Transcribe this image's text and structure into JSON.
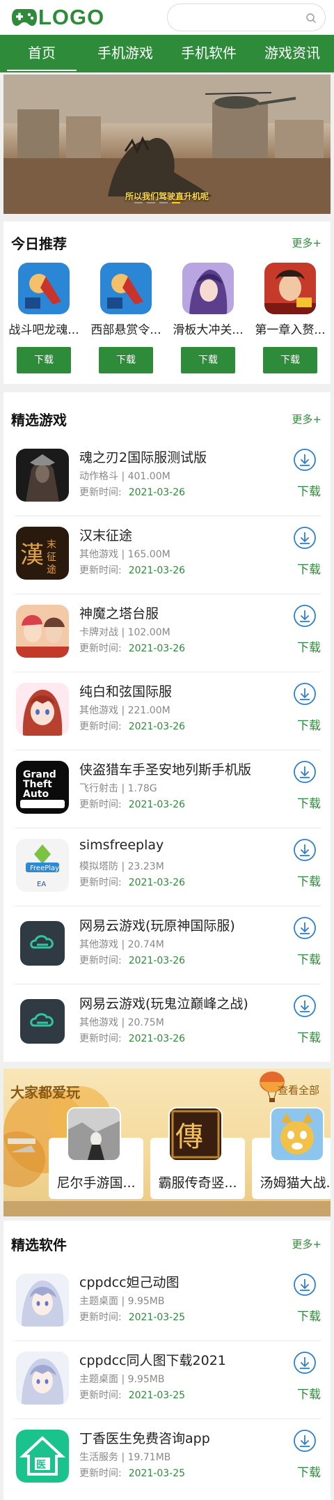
{
  "header": {
    "logo_text": "LOGO",
    "search_placeholder": ""
  },
  "nav": {
    "items": [
      "首页",
      "手机游戏",
      "手机软件",
      "游戏资讯"
    ],
    "active_index": 0
  },
  "banner": {
    "caption": "所以我们驾驶直升机呢",
    "slide_count": 4,
    "active_slide": 3
  },
  "today": {
    "title": "今日推荐",
    "more": "更多+",
    "items": [
      {
        "name": "战斗吧龙魂...",
        "button": "下载"
      },
      {
        "name": "西部悬赏令...",
        "button": "下载"
      },
      {
        "name": "滑板大冲关...",
        "button": "下载"
      },
      {
        "name": "第一章入赘...",
        "button": "下载"
      }
    ]
  },
  "featured_games": {
    "title": "精选游戏",
    "more": "更多+",
    "date_label": "更新时间:",
    "download_label": "下载",
    "items": [
      {
        "name": "魂之刃2国际服测试版",
        "meta": "动作格斗 | 401.00M",
        "date": "2021-03-26",
        "icon": "dark-warrior-icon"
      },
      {
        "name": "汉末征途",
        "meta": "其他游戏 | 165.00M",
        "date": "2021-03-26",
        "icon": "han-calligraphy-icon"
      },
      {
        "name": "神魔之塔台服",
        "meta": "卡牌对战 | 102.00M",
        "date": "2021-03-26",
        "icon": "tower-heroes-icon"
      },
      {
        "name": "纯白和弦国际服",
        "meta": "其他游戏 | 221.00M",
        "date": "2021-03-26",
        "icon": "anime-girl-icon"
      },
      {
        "name": "侠盗猎车手圣安地列斯手机版",
        "meta": "飞行射击 | 1.78G",
        "date": "2021-03-26",
        "icon": "gta-icon"
      },
      {
        "name": "simsfreeplay",
        "meta": "模拟塔防 | 23.23M",
        "date": "2021-03-26",
        "icon": "freeplay-icon"
      },
      {
        "name": "网易云游戏(玩原神国际服)",
        "meta": "其他游戏 | 20.74M",
        "date": "2021-03-26",
        "icon": "cloud-game-icon"
      },
      {
        "name": "网易云游戏(玩鬼泣巅峰之战)",
        "meta": "其他游戏 | 20.75M",
        "date": "2021-03-26",
        "icon": "cloud-game-icon"
      }
    ]
  },
  "popular": {
    "title": "大家都爱玩",
    "view_all": "查看全部",
    "items": [
      {
        "name": "尼尔手游国..."
      },
      {
        "name": "霸服传奇竖..."
      },
      {
        "name": "汤姆猫大战..."
      }
    ]
  },
  "featured_software": {
    "title": "精选软件",
    "more": "更多+",
    "date_label": "更新时间:",
    "download_label": "下载",
    "items": [
      {
        "name": "cppdcc妲己动图",
        "meta": "主题桌面 | 9.95MB",
        "date": "2021-03-25",
        "icon": "anime-portrait-icon"
      },
      {
        "name": "cppdcc同人图下载2021",
        "meta": "主题桌面 | 9.95MB",
        "date": "2021-03-25",
        "icon": "anime-portrait-icon"
      },
      {
        "name": "丁香医生免费咨询app",
        "meta": "生活服务 | 19.71MB",
        "date": "2021-03-25",
        "icon": "doctor-house-icon"
      }
    ]
  },
  "colors": {
    "brand_green": "#2e8b3a",
    "accent_yellow": "#ffd200",
    "download_blue": "#2a7fd4"
  }
}
